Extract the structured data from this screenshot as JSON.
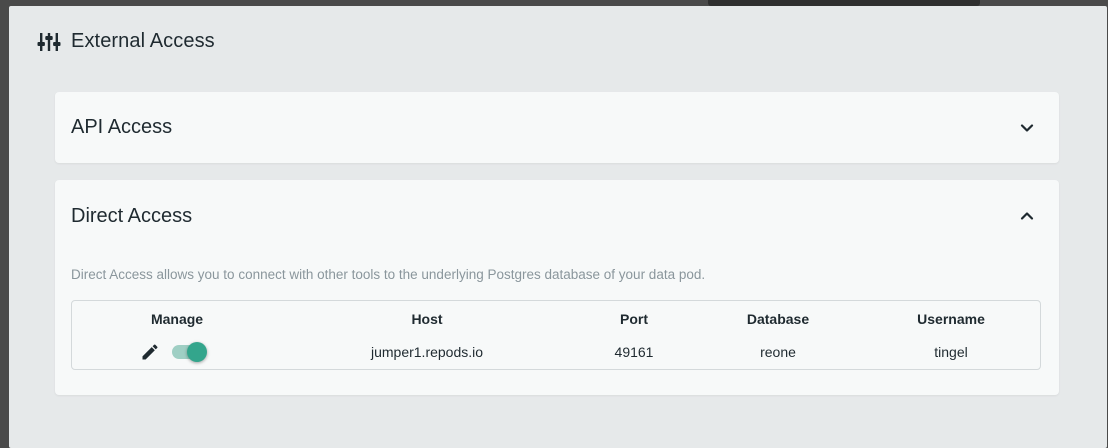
{
  "dialog": {
    "title": "External Access",
    "icon": "sliders-icon"
  },
  "panels": {
    "api": {
      "title": "API Access",
      "expanded": false,
      "icon": "chevron-down-icon"
    },
    "direct": {
      "title": "Direct Access",
      "expanded": true,
      "icon": "chevron-up-icon",
      "description": "Direct Access allows you to connect with other tools to the underlying Postgres database of your data pod.",
      "table": {
        "headers": [
          "Manage",
          "Host",
          "Port",
          "Database",
          "Username"
        ],
        "row": {
          "host": "jumper1.repods.io",
          "port": "49161",
          "database": "reone",
          "username": "tingel",
          "enabled": true
        }
      }
    }
  },
  "colors": {
    "accent": "#33a58c",
    "accent_light": "#9fcfc4",
    "dialog_bg": "#e6e9ea",
    "panel_bg": "#f7f9f9",
    "text": "#1f2a30",
    "muted": "#8a969c"
  }
}
